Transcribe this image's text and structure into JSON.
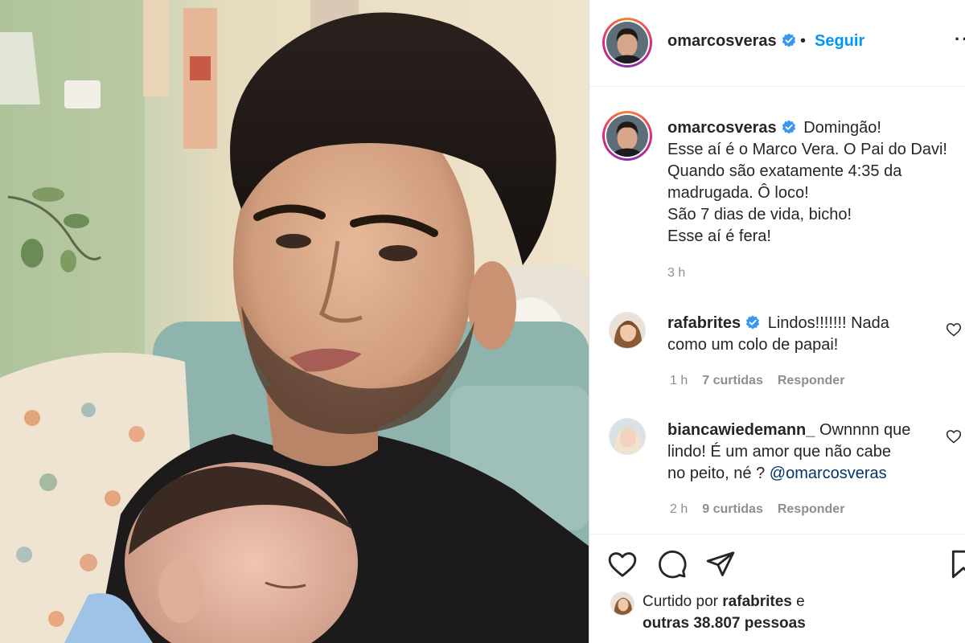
{
  "post": {
    "username": "omarcosveras",
    "follow_label": "Seguir",
    "separator": "•",
    "more": "···"
  },
  "caption": {
    "username": "omarcosveras",
    "lines": [
      "Domingão!",
      "Esse aí é o Marco Vera. O Pai do Davi!",
      "Quando são exatamente 4:35 da",
      "madrugada. Ô loco!",
      "São 7 dias de vida, bicho!",
      "Esse aí é fera!"
    ],
    "time": "3 h"
  },
  "comments": [
    {
      "username": "rafabrites",
      "verified": true,
      "lines": [
        "Lindos!!!!!!! Nada",
        "como um colo de papai!"
      ],
      "time": "1 h",
      "likes": "7 curtidas",
      "reply": "Responder"
    },
    {
      "username": "biancawiedemann_",
      "verified": false,
      "lines": [
        "Ownnnn que",
        "lindo! É um amor que não cabe",
        "no peito, né ? "
      ],
      "mention": "@omarcosveras",
      "time": "2 h",
      "likes": "9 curtidas",
      "reply": "Responder"
    }
  ],
  "liked_by": {
    "prefix": "Curtido por ",
    "user": "rafabrites",
    "suffix": " e",
    "line2": "outras 38.807 pessoas"
  },
  "icons": {
    "verified": "verified-badge-icon",
    "like": "heart-icon",
    "comment": "speech-bubble-icon",
    "share": "paper-plane-icon",
    "save": "bookmark-icon"
  },
  "colors": {
    "follow": "#0095f6",
    "verified": "#3897f0",
    "muted": "#8e8e8e",
    "text": "#262626"
  }
}
